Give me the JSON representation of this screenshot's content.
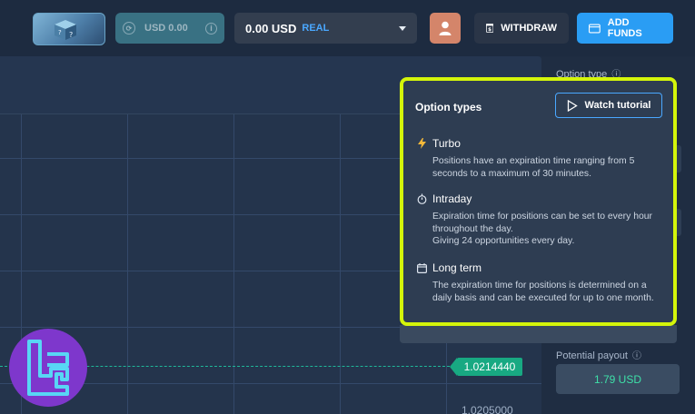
{
  "topbar": {
    "bonus_label": "USD 0.00",
    "account_balance": "0.00 USD",
    "account_type": "REAL",
    "withdraw_label": "WITHDRAW",
    "add_funds_label": "ADD FUNDS"
  },
  "chart": {
    "current_price": "1.0214440",
    "axis_price": "1.0205000",
    "price_line_color": "#1fb89a"
  },
  "sidebar": {
    "option_type_label": "Option type",
    "potential_payout_label": "Potential payout",
    "payout_value": "1.79 USD"
  },
  "popup": {
    "title": "Option types",
    "tutorial_label": "Watch tutorial",
    "options": [
      {
        "icon": "lightning-icon",
        "name": "Turbo",
        "desc": "Positions have an expiration time ranging from 5 seconds to a maximum of 30 minutes."
      },
      {
        "icon": "stopwatch-icon",
        "name": "Intraday",
        "desc": "Expiration time for positions can be set to every hour throughout the day.",
        "desc2": "Giving 24 opportunities every day."
      },
      {
        "icon": "calendar-icon",
        "name": "Long term",
        "desc": "The expiration time for positions is determined on a daily basis and can be executed for up to one month."
      }
    ]
  },
  "colors": {
    "accent": "#2a9df4",
    "highlight_border": "#d4f50a",
    "payout": "#3ee0a8"
  }
}
